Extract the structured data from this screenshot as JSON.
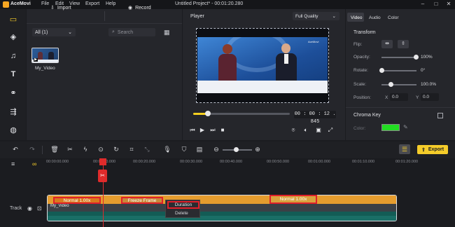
{
  "app": {
    "name": "AceMovi",
    "document_title": "Untitled Project* - 00:01:20.280",
    "menu": [
      "File",
      "Edit",
      "View",
      "Export",
      "Help"
    ]
  },
  "media": {
    "import_label": "Import",
    "record_label": "Record",
    "filter_value": "All (1)",
    "search_placeholder": "Search",
    "items": [
      {
        "label": "My_Video"
      }
    ]
  },
  "player": {
    "label": "Player",
    "quality": "Full Quality",
    "timecode": "00 : 00 : 12 . 845",
    "watermark": "AceMovi",
    "progress_fraction": 0.15
  },
  "properties": {
    "tabs": [
      "Video",
      "Audio",
      "Color"
    ],
    "section_transform": "Transform",
    "flip_label": "Flip:",
    "opacity_label": "Opacity:",
    "opacity_value": "100%",
    "rotate_label": "Rotate:",
    "rotate_value": "0°",
    "scale_label": "Scale:",
    "scale_value": "100.0%",
    "position_label": "Position:",
    "pos_x_label": "X",
    "pos_x_value": "0.0",
    "pos_y_label": "Y",
    "pos_y_value": "0.0",
    "section_chroma": "Chroma Key",
    "color_label": "Color:",
    "chroma_color": "#22dd22"
  },
  "timeline": {
    "export_label": "Export",
    "ticks": [
      "00:00:00.000",
      "00:00:10.000",
      "00:00:20.000",
      "00:00:30.000",
      "00:00:40.000",
      "00:00:50.000",
      "00:01:00.000",
      "00:01:10.000",
      "00:01:20.000"
    ],
    "track_label": "Track",
    "clip_name": "My_Video",
    "segments": [
      "Normal 1.00x",
      "Freeze Frame",
      "Normal 1.00x"
    ],
    "context_menu": [
      "Duration",
      "Delete"
    ]
  },
  "colors": {
    "accent": "#f5cc2a",
    "playhead": "#e02b2b",
    "highlight": "#e0202a",
    "clip_audio": "#e59c2e",
    "clip_video": "#1a6e66"
  }
}
